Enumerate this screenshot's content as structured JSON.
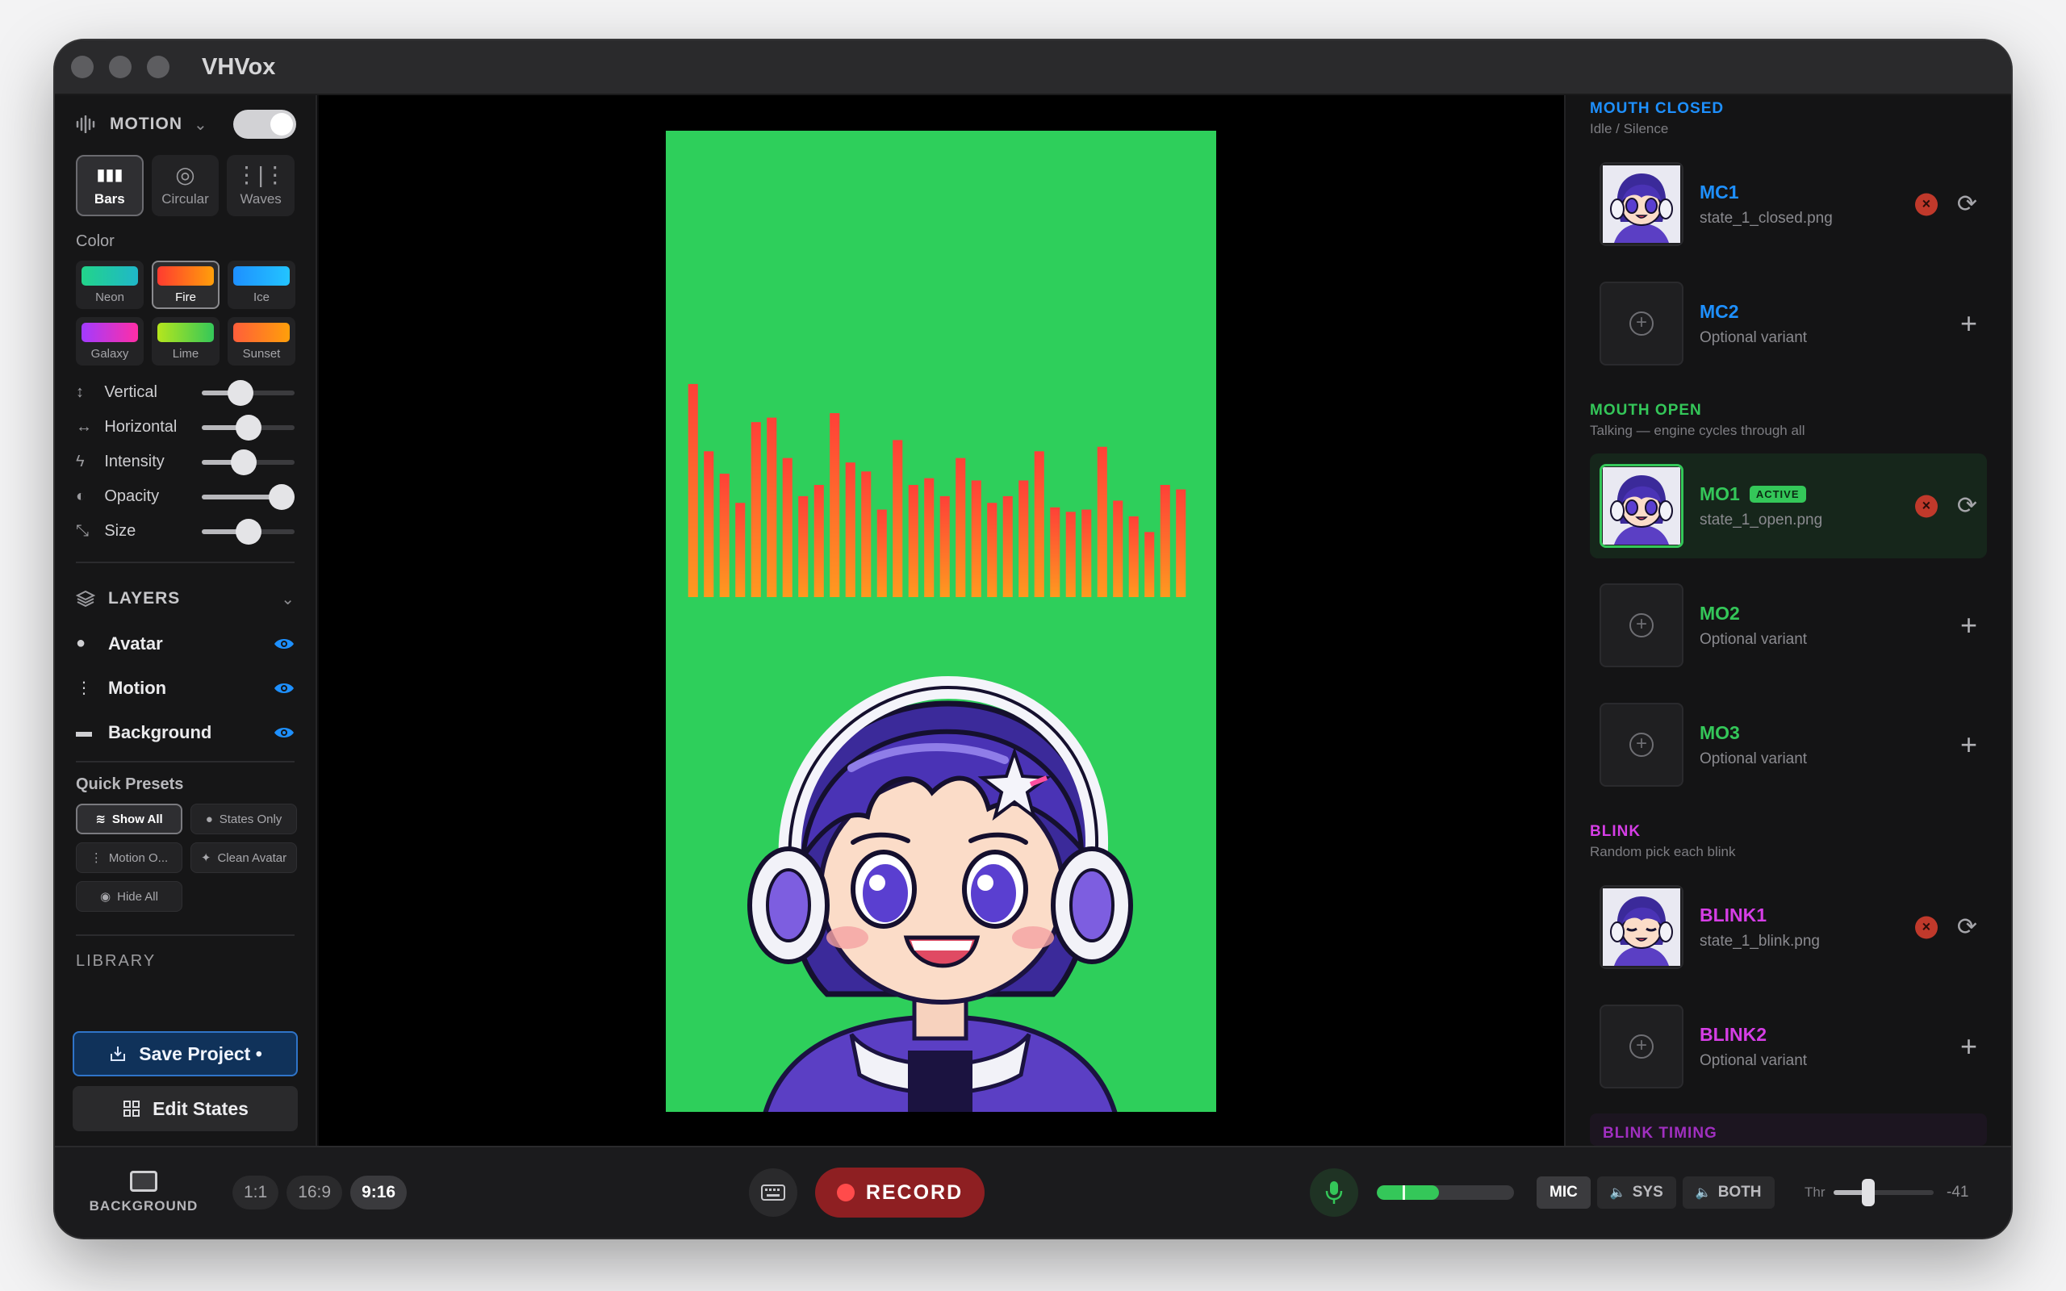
{
  "app": {
    "title": "VHVox"
  },
  "motion": {
    "label": "MOTION",
    "enabled": true,
    "modes": [
      {
        "label": "Bars",
        "icon": "bars-icon",
        "active": true
      },
      {
        "label": "Circular",
        "icon": "circular-icon",
        "active": false
      },
      {
        "label": "Waves",
        "icon": "waves-icon",
        "active": false
      }
    ],
    "color_label": "Color",
    "colors": [
      {
        "label": "Neon",
        "from": "#22d48a",
        "to": "#1fb7c9",
        "active": false
      },
      {
        "label": "Fire",
        "from": "#ff3b30",
        "to": "#ff9f0a",
        "active": true
      },
      {
        "label": "Ice",
        "from": "#1e90ff",
        "to": "#23c4ff",
        "active": false
      },
      {
        "label": "Galaxy",
        "from": "#a23bff",
        "to": "#ff2ea6",
        "active": false
      },
      {
        "label": "Lime",
        "from": "#b5e61d",
        "to": "#34c759",
        "active": false
      },
      {
        "label": "Sunset",
        "from": "#ff5e3a",
        "to": "#ff9f0a",
        "active": false
      }
    ],
    "sliders": [
      {
        "label": "Vertical",
        "icon": "vertical-arrows-icon",
        "value": 0.42
      },
      {
        "label": "Horizontal",
        "icon": "horizontal-arrows-icon",
        "value": 0.5
      },
      {
        "label": "Intensity",
        "icon": "bolt-icon",
        "value": 0.45
      },
      {
        "label": "Opacity",
        "icon": "contrast-icon",
        "value": 0.86
      },
      {
        "label": "Size",
        "icon": "resize-icon",
        "value": 0.5
      }
    ]
  },
  "layers": {
    "label": "LAYERS",
    "items": [
      {
        "label": "Avatar",
        "icon": "person-icon",
        "visible": true
      },
      {
        "label": "Motion",
        "icon": "waveform-icon",
        "visible": true
      },
      {
        "label": "Background",
        "icon": "rectangle-icon",
        "visible": true
      }
    ]
  },
  "presets": {
    "label": "Quick Presets",
    "items": [
      {
        "label": "Show All",
        "icon": "layers-icon",
        "active": true
      },
      {
        "label": "States Only",
        "icon": "person-icon",
        "active": false
      },
      {
        "label": "Motion O...",
        "icon": "waveform-icon",
        "active": false
      },
      {
        "label": "Clean Avatar",
        "icon": "sparkle-icon",
        "active": false
      },
      {
        "label": "Hide All",
        "icon": "eye-off-icon",
        "active": false
      }
    ]
  },
  "library_peek": "LIBRARY",
  "footer": {
    "save_label": "Save Project •",
    "edit_label": "Edit States"
  },
  "visualizer": {
    "bar_heights": [
      0.95,
      0.65,
      0.55,
      0.42,
      0.78,
      0.8,
      0.62,
      0.45,
      0.5,
      0.82,
      0.6,
      0.56,
      0.39,
      0.7,
      0.5,
      0.53,
      0.45,
      0.62,
      0.52,
      0.42,
      0.45,
      0.52,
      0.65,
      0.4,
      0.38,
      0.39,
      0.67,
      0.43,
      0.36,
      0.29,
      0.5,
      0.48
    ],
    "colors": {
      "top": "#ff4038",
      "bottom": "#ff9a1f",
      "background": "#2ecf5b"
    }
  },
  "groups": [
    {
      "title": "MOUTH CLOSED",
      "subtitle": "Idle / Silence",
      "color": "#1e90ff",
      "states": [
        {
          "name": "MC1",
          "file": "state_1_closed.png",
          "filled": true,
          "active": false
        },
        {
          "name": "MC2",
          "file": "Optional variant",
          "filled": false,
          "active": false
        }
      ]
    },
    {
      "title": "MOUTH OPEN",
      "subtitle": "Talking — engine cycles through all",
      "color": "#34c759",
      "states": [
        {
          "name": "MO1",
          "file": "state_1_open.png",
          "filled": true,
          "active": true,
          "badge": "ACTIVE"
        },
        {
          "name": "MO2",
          "file": "Optional variant",
          "filled": false,
          "active": false
        },
        {
          "name": "MO3",
          "file": "Optional variant",
          "filled": false,
          "active": false
        }
      ]
    },
    {
      "title": "BLINK",
      "subtitle": "Random pick each blink",
      "color": "#d63ee6",
      "states": [
        {
          "name": "BLINK1",
          "file": "state_1_blink.png",
          "filled": true,
          "active": false
        },
        {
          "name": "BLINK2",
          "file": "Optional variant",
          "filled": false,
          "active": false
        }
      ]
    }
  ],
  "timing_peek": "BLINK TIMING",
  "bottom": {
    "background_label": "BACKGROUND",
    "ratios": [
      {
        "label": "1:1",
        "active": false
      },
      {
        "label": "16:9",
        "active": false
      },
      {
        "label": "9:16",
        "active": true
      }
    ],
    "record_label": "RECORD",
    "meter_level": 0.45,
    "sources": [
      {
        "label": "MIC",
        "active": true
      },
      {
        "label": "SYS",
        "active": false
      },
      {
        "label": "BOTH",
        "active": false
      }
    ],
    "threshold_label": "Thr",
    "threshold_value": "-41",
    "threshold_level": 0.35
  }
}
